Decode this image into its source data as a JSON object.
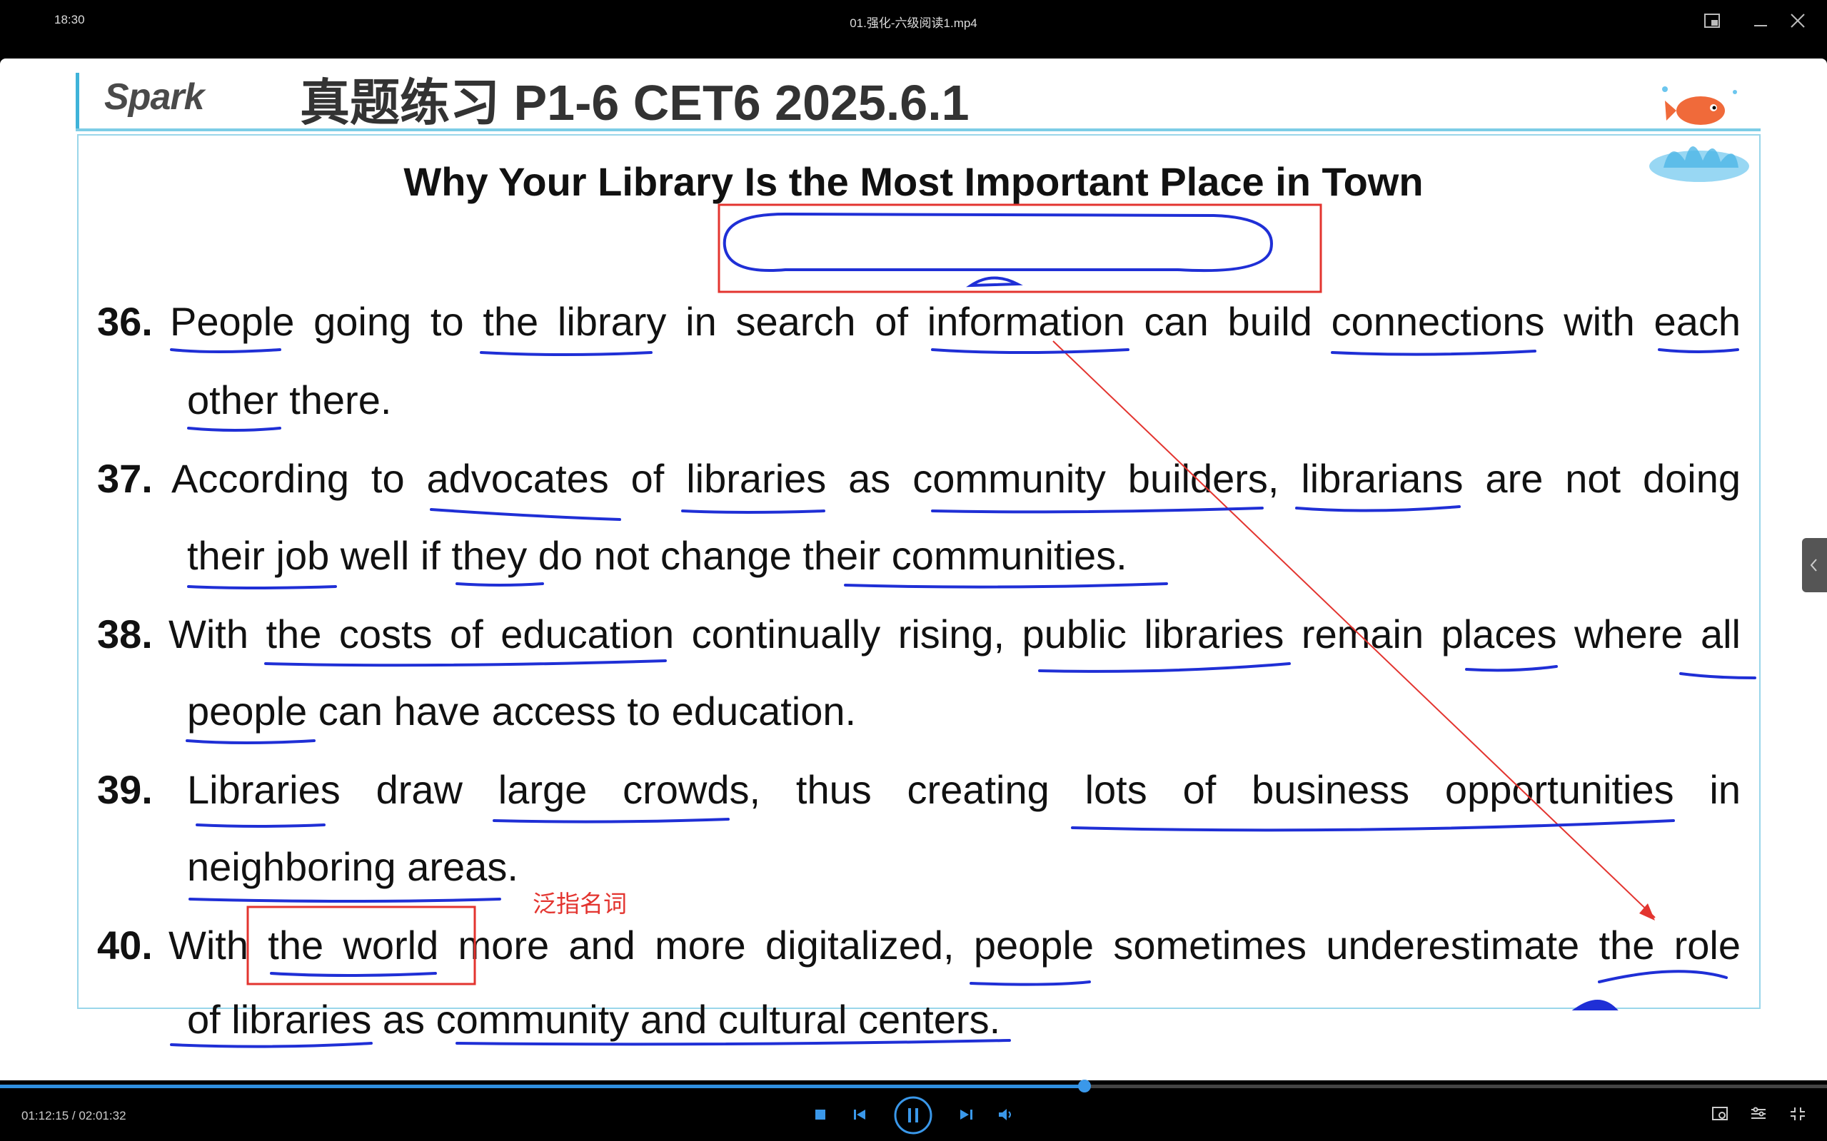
{
  "window": {
    "clock": "18:30",
    "title": "01.强化-六级阅读1.mp4"
  },
  "slide": {
    "logo": "Spark",
    "heading": "真题练习  P1-6  CET6 2025.6.1",
    "doc_title": "Why Your Library Is the Most Important Place in Town",
    "items": [
      {
        "num": "36.",
        "line1": "People going to the library in search of information can build connections with each",
        "line2": "other there."
      },
      {
        "num": "37.",
        "line1": "According to advocates of libraries as community builders, librarians are not doing",
        "line2": "their job well if they do not change their communities."
      },
      {
        "num": "38.",
        "line1": "With the costs of education continually rising, public libraries remain places where all",
        "line2": "people can have access to education."
      },
      {
        "num": "39.",
        "line1": "Libraries draw large crowds, thus creating lots of business opportunities in",
        "line2": "neighboring areas."
      },
      {
        "num": "40.",
        "line1": "With the world more and more digitalized, people sometimes underestimate the role",
        "line2": "of libraries as community and cultural centers."
      }
    ],
    "annotation": "泛指名词"
  },
  "player": {
    "time": "01:12:15 / 02:01:32",
    "progress": 0.5936
  },
  "colors": {
    "accent": "#2f8fe0",
    "pen_blue": "#1f2fd6",
    "pen_red": "#e3342f"
  }
}
